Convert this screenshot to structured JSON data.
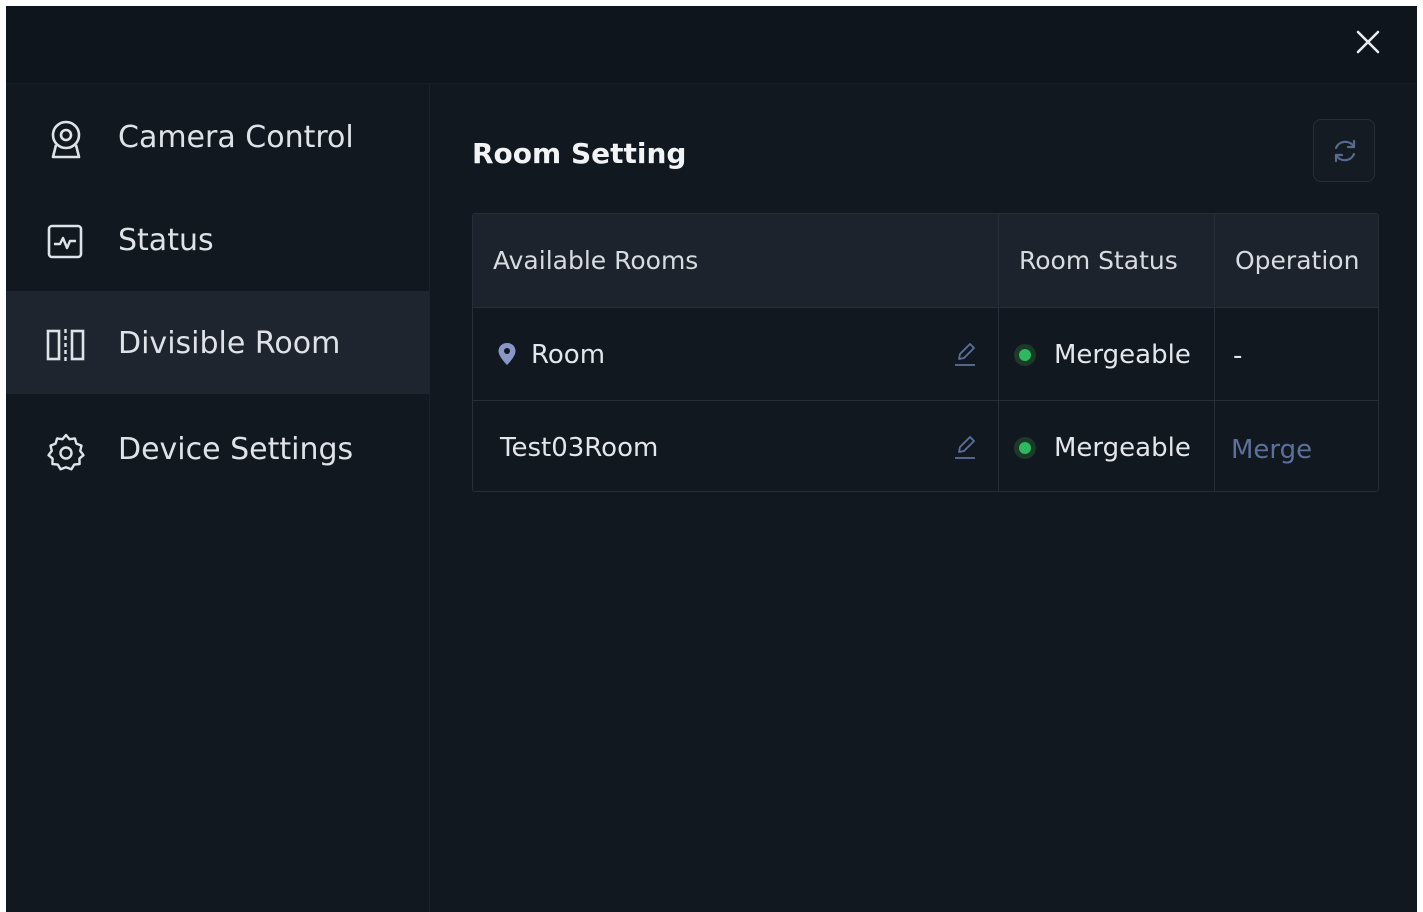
{
  "window": {
    "close_icon": "close-icon"
  },
  "sidebar": {
    "items": [
      {
        "label": "Camera Control",
        "icon": "camera-icon",
        "active": false
      },
      {
        "label": "Status",
        "icon": "pulse-icon",
        "active": false
      },
      {
        "label": "Divisible Room",
        "icon": "divisible-room-icon",
        "active": true
      },
      {
        "label": "Device Settings",
        "icon": "gear-icon",
        "active": false
      }
    ]
  },
  "main": {
    "title": "Room Setting",
    "refresh_icon": "refresh-icon",
    "table": {
      "headers": [
        "Available Rooms",
        "Room Status",
        "Operation"
      ],
      "rows": [
        {
          "room": "Room",
          "has_pin": true,
          "status": "Mergeable",
          "operation": "-"
        },
        {
          "room": "Test03Room",
          "has_pin": false,
          "status": "Mergeable",
          "operation": "Merge"
        }
      ]
    }
  },
  "colors": {
    "background": "#111820",
    "active_item": "#1e252e",
    "status_green": "#2eb860",
    "link": "#5d7099",
    "pin": "#8a96c6"
  }
}
